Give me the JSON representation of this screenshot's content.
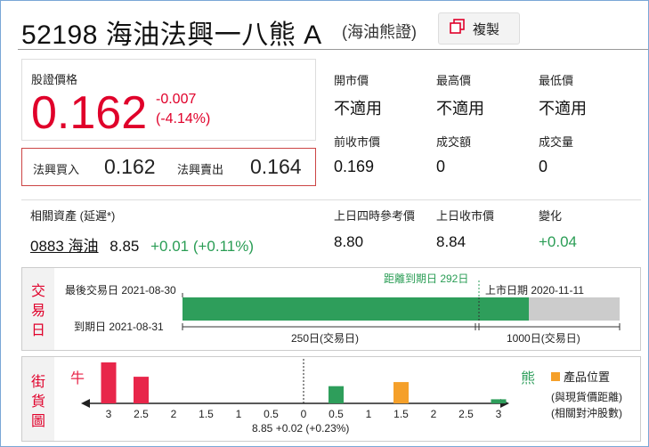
{
  "header": {
    "code": "52198 海油法興一八熊 A",
    "underlying_name": "(海油熊證)",
    "copy_label": "複製",
    "copy_icon": "copy-icon"
  },
  "quote": {
    "price_label": "股證價格",
    "price": "0.162",
    "change": "-0.007",
    "change_pct": "(-4.14%)",
    "bid_label": "法興買入",
    "bid": "0.162",
    "ask_label": "法興賣出",
    "ask": "0.164"
  },
  "stats": {
    "open_label": "開市價",
    "open_value": "不適用",
    "high_label": "最高價",
    "high_value": "不適用",
    "low_label": "最低價",
    "low_value": "不適用",
    "prev_close_label": "前收市價",
    "prev_close_value": "0.169",
    "turnover_label": "成交額",
    "turnover_value": "0",
    "volume_label": "成交量",
    "volume_value": "0"
  },
  "related": {
    "label": "相關資產 (延遲*)",
    "code_name": "0883 海油",
    "price": "8.85",
    "change": "+0.01 (+0.11%)",
    "ref_label": "上日四時參考價",
    "ref_value": "8.80",
    "prev_close_label": "上日收市價",
    "prev_close_value": "8.84",
    "change_label": "變化",
    "change_value": "+0.04"
  },
  "trading_days": {
    "title": "交易日",
    "last_trade_label": "最後交易日 2021-08-30",
    "days_to_expiry_label": "距離到期日 292日",
    "listing_label": "上市日期 2020-11-11",
    "expiry_label": "到期日 2021-08-31",
    "elapsed_label": "250日(交易日)",
    "remaining_label": "1000日(交易日)",
    "elapsed_fraction": 0.8,
    "colors": {
      "elapsed": "#2e9e5b",
      "remaining": "#cccccc"
    }
  },
  "street": {
    "title": "街貨圖",
    "bull_label": "牛",
    "bear_label": "熊",
    "legend_label": "產品位置",
    "note1": "(與現貨價距離)",
    "note2": "(相關對沖股數)",
    "center_label": "8.85 +0.02 (+0.23%)",
    "ticks": [
      "3",
      "2.5",
      "2",
      "1.5",
      "1",
      "0.5",
      "0",
      "0.5",
      "1",
      "1.5",
      "2",
      "2.5",
      "3"
    ],
    "bars": [
      {
        "side": "bull",
        "distance": 3,
        "level": 1.0,
        "color": "#e8264a"
      },
      {
        "side": "bull",
        "distance": 2.5,
        "level": 0.65,
        "color": "#e8264a"
      },
      {
        "side": "bear",
        "distance": 0.5,
        "level": 0.42,
        "color": "#2e9e5b"
      },
      {
        "side": "bear",
        "distance": 1.5,
        "level": 0.52,
        "color": "#f5a02a"
      },
      {
        "side": "bear",
        "distance": 3,
        "level": 0.1,
        "color": "#2e9e5b"
      }
    ],
    "colors": {
      "bull": "#e8264a",
      "bear": "#2e9e5b",
      "product": "#f5a02a"
    }
  }
}
